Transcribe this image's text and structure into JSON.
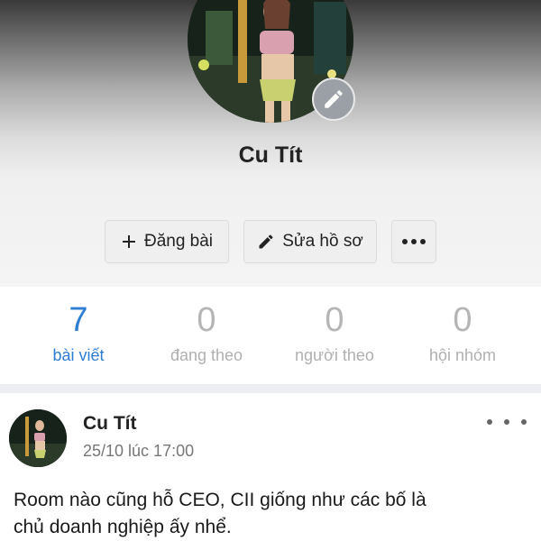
{
  "profile": {
    "name": "Cu Tít"
  },
  "actions": {
    "post_label": "Đăng bài",
    "edit_label": "Sửa hồ sơ"
  },
  "stats": [
    {
      "value": "7",
      "label": "bài viết"
    },
    {
      "value": "0",
      "label": "đang theo"
    },
    {
      "value": "0",
      "label": "người theo"
    },
    {
      "value": "0",
      "label": "hội nhóm"
    }
  ],
  "post": {
    "author": "Cu Tít",
    "time": "25/10 lúc 17:00",
    "text_line1": "Room nào cũng hỗ CEO, CII giống như các bố là",
    "text_line2": "chủ doanh nghiệp ấy nhể."
  },
  "colors": {
    "accent": "#2d7dd2",
    "muted": "#b0b0b0"
  },
  "icons": {
    "edit_avatar": "pencil-icon",
    "post": "plus-icon",
    "edit_profile": "pencil-icon",
    "more": "more-dots-icon"
  }
}
